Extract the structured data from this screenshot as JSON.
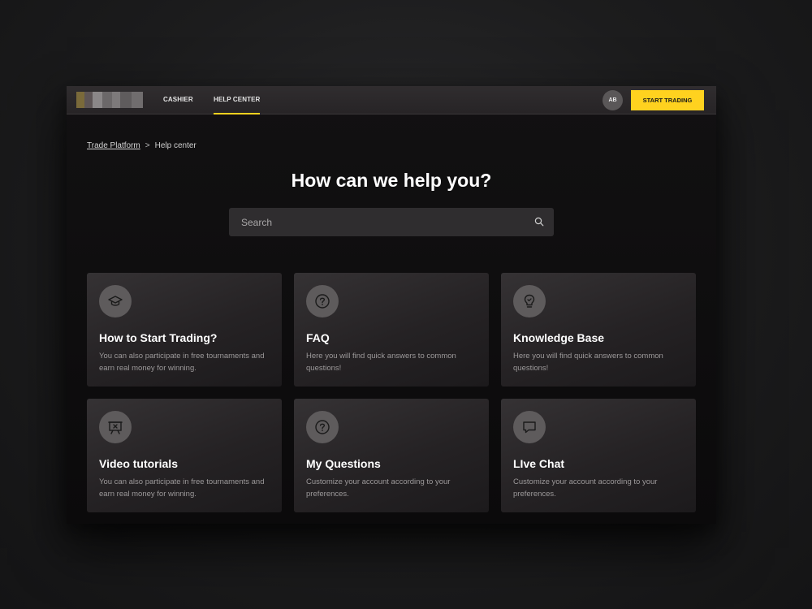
{
  "nav": {
    "items": [
      {
        "label": "CASHIER"
      },
      {
        "label": "HELP CENTER"
      }
    ],
    "avatar_initials": "AB",
    "start_trading_label": "START TRADING"
  },
  "breadcrumb": {
    "root": "Trade Platform",
    "separator": ">",
    "current": "Help center"
  },
  "headline": "How can we help you?",
  "search": {
    "placeholder": "Search"
  },
  "cards": [
    {
      "title": "How to Start Trading?",
      "desc": "You can also participate in free tournaments and earn real money for winning.",
      "icon": "graduation-cap-icon"
    },
    {
      "title": "FAQ",
      "desc": "Here you will find quick answers to common questions!",
      "icon": "question-circle-icon"
    },
    {
      "title": "Knowledge Base",
      "desc": "Here you will find quick answers to common questions!",
      "icon": "lightbulb-icon"
    },
    {
      "title": "Video tutorials",
      "desc": "You can also participate in free tournaments and earn real money for winning.",
      "icon": "presentation-icon"
    },
    {
      "title": "My Questions",
      "desc": "Customize your account according to your preferences.",
      "icon": "question-circle-icon"
    },
    {
      "title": "LIve Chat",
      "desc": "Customize your account according to your preferences.",
      "icon": "chat-bubble-icon"
    }
  ],
  "colors": {
    "accent": "#ffd21f",
    "background": "#0b0a0b",
    "card": "#2a2729",
    "icon_circle": "#5e5b5c"
  }
}
